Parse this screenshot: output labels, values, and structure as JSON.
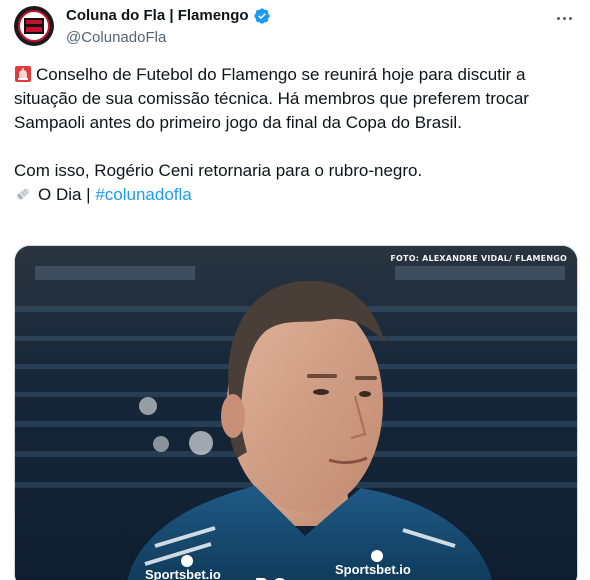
{
  "author": {
    "display_name": "Coluna do Fla | Flamengo",
    "handle": "@ColunadoFla",
    "verified": true,
    "avatar_icon": "coluna-do-fla-logo",
    "brand_color": "#c8102e"
  },
  "tweet": {
    "paragraph_1_icon": "police-car-light-emoji",
    "paragraph_1": "Conselho de Futebol do Flamengo se reunirá hoje para discutir a situação de sua comissão técnica. Há membros que preferem trocar Sampaoli antes do primeiro jogo da final da Copa do Brasil.",
    "paragraph_2": "Com isso, Rogério Ceni retornaria para o rubro-negro.",
    "source_icon": "rolled-newspaper-emoji",
    "source_text": "O Dia |",
    "hashtag": "#colunadofla",
    "link_color": "#1d9bf0"
  },
  "media": {
    "photo_credit": "FOTO: ALEXANDRE VIDAL/ FLAMENGO",
    "sponsor_left": "Sportsbet.io",
    "sponsor_right": "Sportsbet.io",
    "shirt_initials": "R C"
  },
  "icons": {
    "more": "more-options-icon",
    "verified": "verified-badge-icon"
  }
}
